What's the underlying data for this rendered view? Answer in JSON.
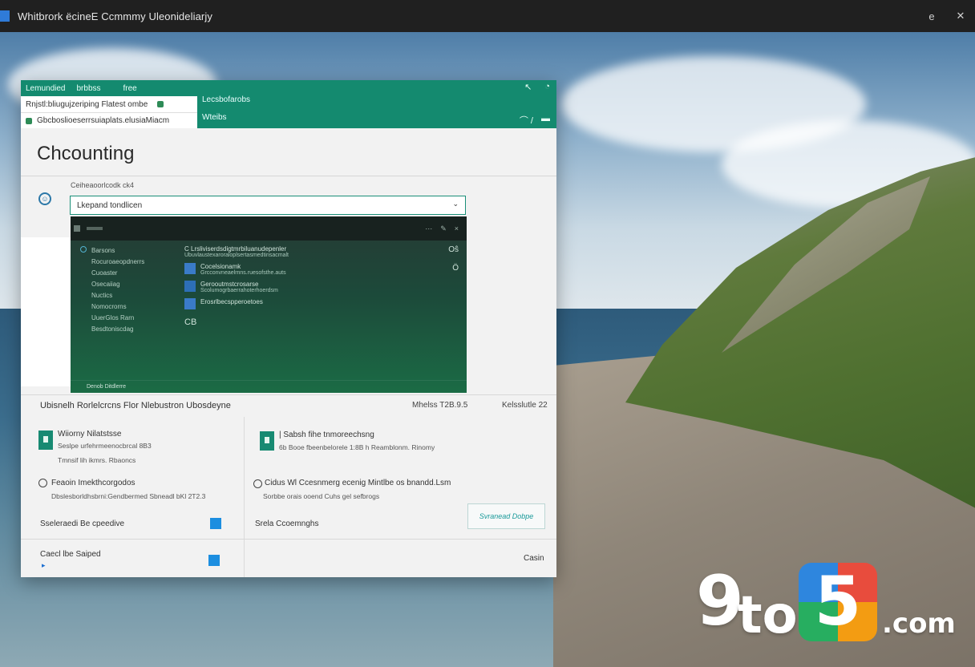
{
  "titlebar": {
    "title": "Whitbrork ëcineE Ccmmmy Uleonideliarjy",
    "btn_a": "e",
    "btn_b": "✕"
  },
  "window": {
    "topstrip": [
      "Lemundied",
      "brbbss",
      "free"
    ],
    "tabs": {
      "line1": "Rnjstl:bliugujzeriping Flatest ombe",
      "line2": "Gbcboslioeserrsuiaplats.elusiaMiacm"
    },
    "header_link1": "Lecsbofarobs",
    "header_link2": "Wteibs",
    "header_ctrl_a": "↖",
    "header_ctrl_b": "◔",
    "header_ctrl_c": "⌒ /",
    "header_ctrl_d": "▬",
    "page_title": "Chcounting",
    "field_label": "Ceiheaoorlcodk ck4",
    "select_value": "Lkepand tondlicen",
    "select_chevron": "⌄",
    "smile": "☺"
  },
  "preview": {
    "nav": [
      "Barsons",
      "Rocuroaeopdnerrs",
      "Cuoaster",
      "Osecaiiag",
      "Nuctics",
      "Nomocrorns",
      "UuerGlos Rarn",
      "Besdtoniscdag"
    ],
    "main": [
      {
        "title": "C Lrsliviserdsdigtmrbiluanudepenler",
        "sub": "Ubuvlaustexaroraloplsertasmedtinsacmalt"
      },
      {
        "title": "Cocelsionamk",
        "sub": "Grcconvneaelrnns.ruesofsthe.auts"
      },
      {
        "title": "Gerooutmstcrosarse",
        "sub": "Scolumogrbaerrahoterhoerdsm"
      },
      {
        "title": "Erosrlbecspperoetoes",
        "sub": ""
      }
    ],
    "right_a": "Oŝ",
    "right_b": "Ö",
    "cs": "CB",
    "footer": "Denob   Ditdlerre"
  },
  "sections": {
    "title": "Ubisnelh Rorlelcrcns Flor Nlebustron Ubosdeyne",
    "meta1": "Mhelss T2B.9.5",
    "meta2": "Kelsslutle 22",
    "card1": {
      "title": "Wiiorny Nilatstsse",
      "sub1": "Seslpe urfehrmeenocbrcal 8B3",
      "sub2": "Tmnsif lih ikmrs. Rbaoncs"
    },
    "card2": {
      "title": "| Sabsh fihe tnmoreechsng",
      "sub": "6b Booe fbeenbelorele 1:8B h Reamblonm. Rinomy"
    },
    "radio1": {
      "title": "Feaoin Imekthcorgodos",
      "sub": "Dbslesborldhsbrni:Gendbermed  Sbneadl bKl 2T2.3"
    },
    "radio2": {
      "title": "Cidus Wl Ccesnmerg ecenig Mintlbe os bnandd.Lsm",
      "sub": "Sorbbe orais ooend Cuhs gel sefbrogs"
    },
    "row1_left": "Sseleraedi Be cpeedive",
    "row1_mid": "Srela Ccoemnghs",
    "row1_btn": "Svranead Dobpe",
    "row2_left": "Caecl lbe Saiped",
    "row2_right": "Casin"
  },
  "watermark": {
    "n1": "9",
    "t": "to",
    "n2": "5",
    "dotcom": ".com"
  }
}
